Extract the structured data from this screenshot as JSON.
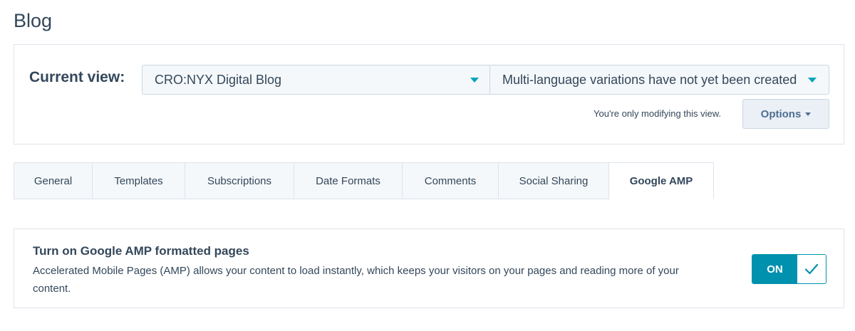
{
  "page": {
    "title": "Blog"
  },
  "view": {
    "label": "Current view:",
    "blog_select": "CRO:NYX Digital Blog",
    "language_select": "Multi-language variations have not yet been created",
    "note": "You're only modifying this view.",
    "options_label": "Options"
  },
  "tabs": [
    {
      "label": "General"
    },
    {
      "label": "Templates"
    },
    {
      "label": "Subscriptions"
    },
    {
      "label": "Date Formats"
    },
    {
      "label": "Comments"
    },
    {
      "label": "Social Sharing"
    },
    {
      "label": "Google AMP",
      "active": true
    }
  ],
  "amp": {
    "title": "Turn on Google AMP formatted pages",
    "description": "Accelerated Mobile Pages (AMP) allows your content to load instantly, which keeps your visitors on your pages and reading more of your content.",
    "toggle_label": "ON"
  },
  "colors": {
    "accent": "#00a4bd",
    "toggle_on": "#0091ae",
    "text": "#33475b",
    "border": "#dfe3eb",
    "tab_bg": "#f5f8fa"
  },
  "icons": {
    "select_caret": "caret-down-icon",
    "options_caret": "caret-down-icon",
    "toggle_check": "checkmark-icon"
  }
}
